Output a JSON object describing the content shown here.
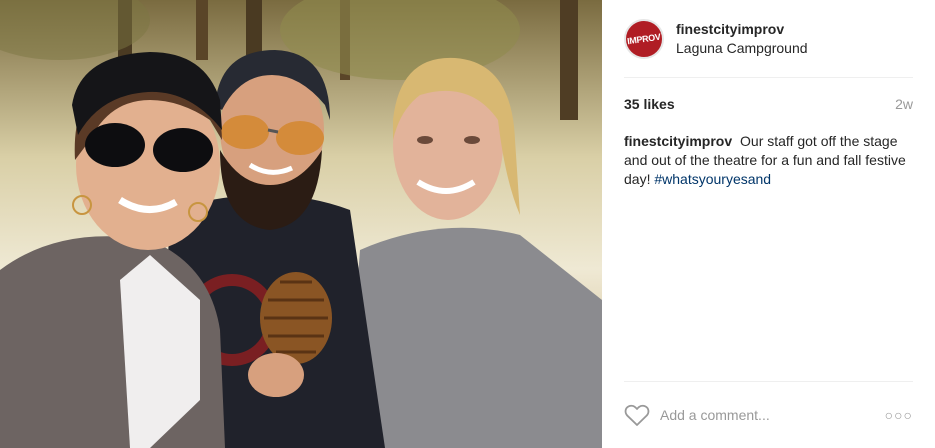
{
  "post": {
    "username": "finestcityimprov",
    "location": "Laguna Campground",
    "avatar_text": "IMPROV",
    "likes": "35 likes",
    "age": "2w",
    "caption_text": "Our staff got off the stage and out of the theatre for a fun and fall festive day!",
    "hashtag": "#whatsyouryesand",
    "comment_placeholder": "Add a comment...",
    "more_glyph": "○○○"
  },
  "colors": {
    "brand": "#b01d24",
    "hashtag": "#003569",
    "muted": "#999999"
  }
}
